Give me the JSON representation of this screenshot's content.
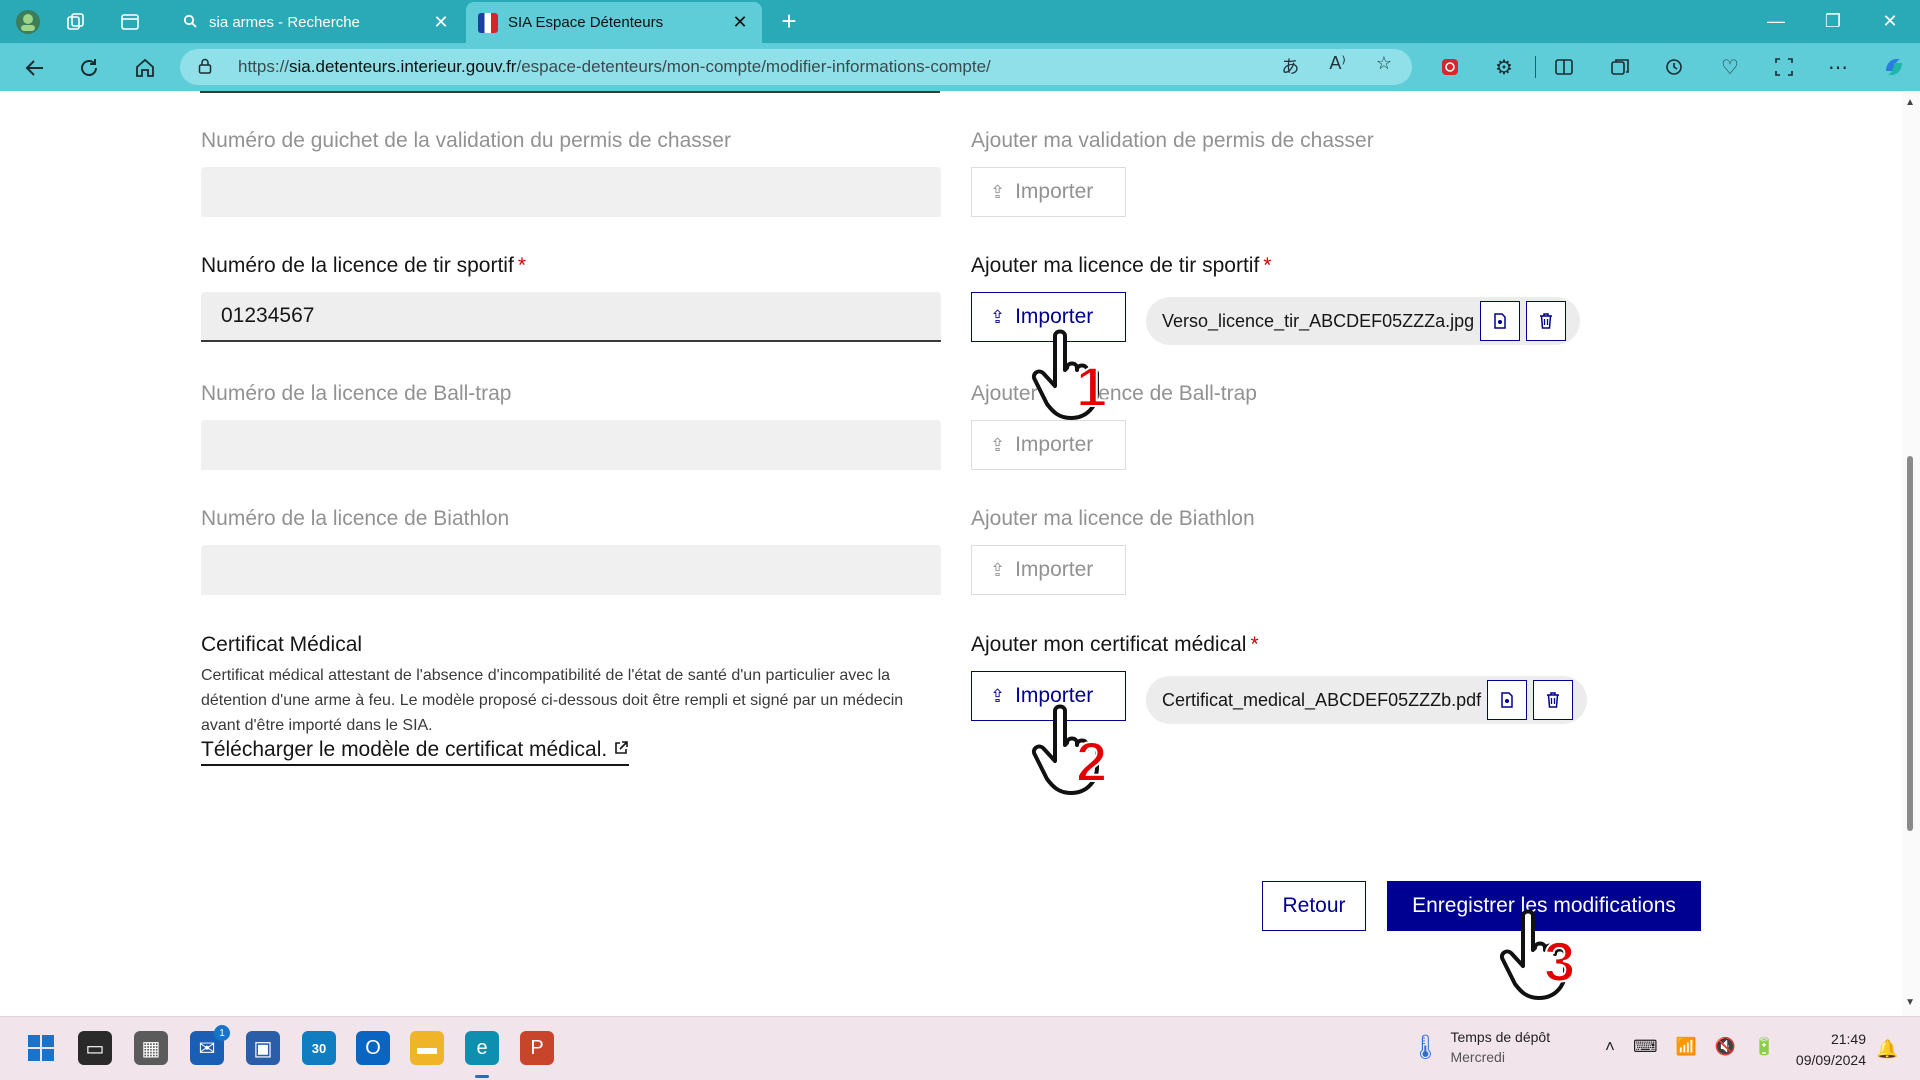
{
  "browser": {
    "tabs": [
      {
        "title": "sia armes - Recherche",
        "icon": "search-icon",
        "active": false
      },
      {
        "title": "SIA Espace Détenteurs",
        "icon": "french-flag-icon",
        "active": true
      }
    ],
    "url": {
      "scheme": "https://",
      "host": "sia.detenteurs.interieur.gouv.fr",
      "path": "/espace-detenteurs/mon-compte/modifier-informations-compte/"
    }
  },
  "form": {
    "guichet": {
      "label": "Numéro de guichet de la validation du permis de chasser",
      "value": "",
      "upload_label": "Ajouter ma validation de permis de chasser",
      "import_label": "Importer"
    },
    "tir_sportif": {
      "label": "Numéro de la licence de tir sportif",
      "required_mark": "*",
      "value": "01234567",
      "upload_label": "Ajouter ma licence de tir sportif",
      "import_label": "Importer",
      "file_name": "Verso_licence_tir_ABCDEF05ZZZa.jpg"
    },
    "ball_trap": {
      "label": "Numéro de la licence de Ball-trap",
      "value": "",
      "upload_label": "Ajouter ma licence de Ball-trap",
      "import_label": "Importer"
    },
    "biathlon": {
      "label": "Numéro de la licence de Biathlon",
      "value": "",
      "upload_label": "Ajouter ma licence de Biathlon",
      "import_label": "Importer"
    },
    "certificat": {
      "title": "Certificat Médical",
      "description": "Certificat médical attestant de l'absence d'incompatibilité de l'état de santé d'un particulier avec la détention d'une arme à feu. Le modèle proposé ci-dessous doit être rempli et signé par un médecin avant d'être importé dans le SIA.",
      "link_label": "Télécharger le modèle de certificat médical.",
      "upload_label": "Ajouter mon certificat médical",
      "required_mark": "*",
      "import_label": "Importer",
      "file_name": "Certificat_medical_ABCDEF05ZZZb.pdf"
    },
    "actions": {
      "back_label": "Retour",
      "save_label": "Enregistrer les modifications"
    }
  },
  "annotations": {
    "step1": "1",
    "step2": "2",
    "step3": "3"
  },
  "taskbar": {
    "weather_title": "Temps de dépôt",
    "weather_sub": "Mercredi",
    "time": "21:49",
    "date": "09/09/2024",
    "mail_badge": "1",
    "calendar_label": "30"
  },
  "colors": {
    "primary": "#000091",
    "required": "#ce0500",
    "browser_tabbar": "#2aa9b7",
    "browser_toolbar": "#5fcdd8",
    "annotation": "#e30000"
  }
}
